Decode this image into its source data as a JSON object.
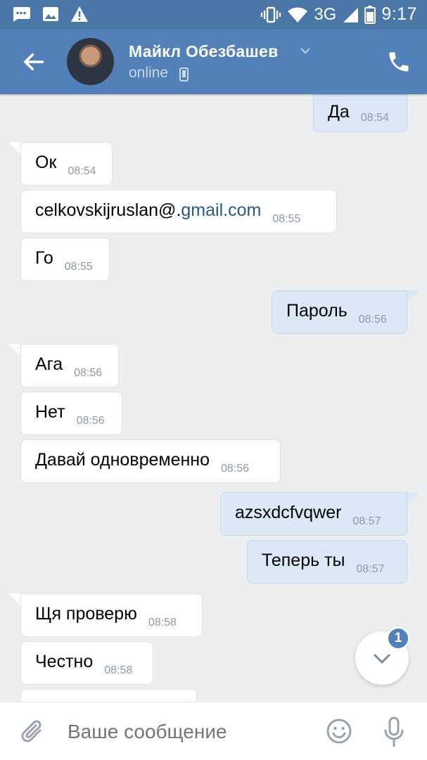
{
  "status_bar": {
    "network": "3G",
    "time": "9:17"
  },
  "header": {
    "name": "Майкл Обезбашев",
    "status": "online"
  },
  "messages": [
    {
      "dir": "out",
      "text": "Да",
      "time": "08:54"
    },
    {
      "dir": "in",
      "text": "Ок",
      "time": "08:54"
    },
    {
      "dir": "in",
      "text_prefix": "celkovskijruslan@.",
      "text_link": "gmail.com",
      "time": "08:55"
    },
    {
      "dir": "in",
      "text": "Го",
      "time": "08:55"
    },
    {
      "dir": "out",
      "text": "Пароль",
      "time": "08:56"
    },
    {
      "dir": "in",
      "text": "Ага",
      "time": "08:56"
    },
    {
      "dir": "in",
      "text": "Нет",
      "time": "08:56"
    },
    {
      "dir": "in",
      "text": "Давай одновременно",
      "time": "08:56"
    },
    {
      "dir": "out",
      "text": "azsxdcfvqwer",
      "time": "08:57"
    },
    {
      "dir": "out",
      "text": "Теперь ты",
      "time": "08:57"
    },
    {
      "dir": "in",
      "text": "Щя проверю",
      "time": "08:58"
    },
    {
      "dir": "in",
      "text": "Честно",
      "time": "08:58"
    }
  ],
  "scroll_down": {
    "unread_count": "1"
  },
  "composer": {
    "placeholder": "Ваше сообщение"
  },
  "colors": {
    "header": "#5181b8",
    "status_bar": "#4a76a8",
    "outgoing": "#dce8f6",
    "incoming": "#ffffff",
    "background": "#edeef0"
  }
}
